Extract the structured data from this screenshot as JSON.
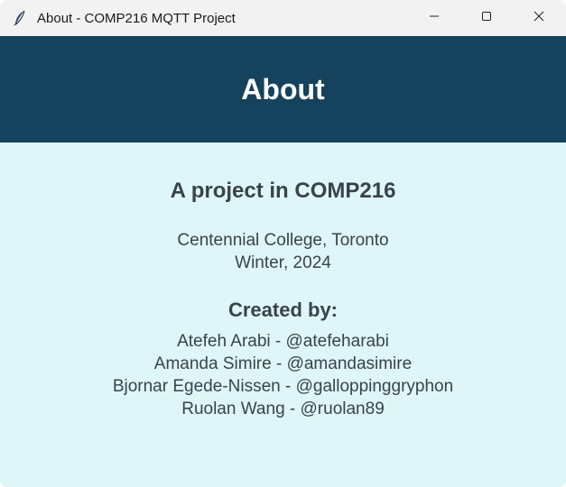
{
  "window": {
    "title": "About - COMP216 MQTT Project",
    "app_icon": "feather-icon"
  },
  "controls": {
    "minimize_icon": "minimize-icon",
    "maximize_icon": "maximize-icon",
    "close_icon": "close-icon"
  },
  "header": {
    "title": "About",
    "background": "#15425d"
  },
  "content": {
    "background": "#dff6f9",
    "project_title": "A project in COMP216",
    "college": "Centennial College, Toronto",
    "term": "Winter, 2024",
    "created_heading": "Created by:",
    "authors": [
      "Atefeh Arabi - @atefeharabi",
      "Amanda Simire - @amandasimire",
      "Bjornar Egede-Nissen - @galloppinggryphon",
      "Ruolan Wang - @ruolan89"
    ]
  }
}
